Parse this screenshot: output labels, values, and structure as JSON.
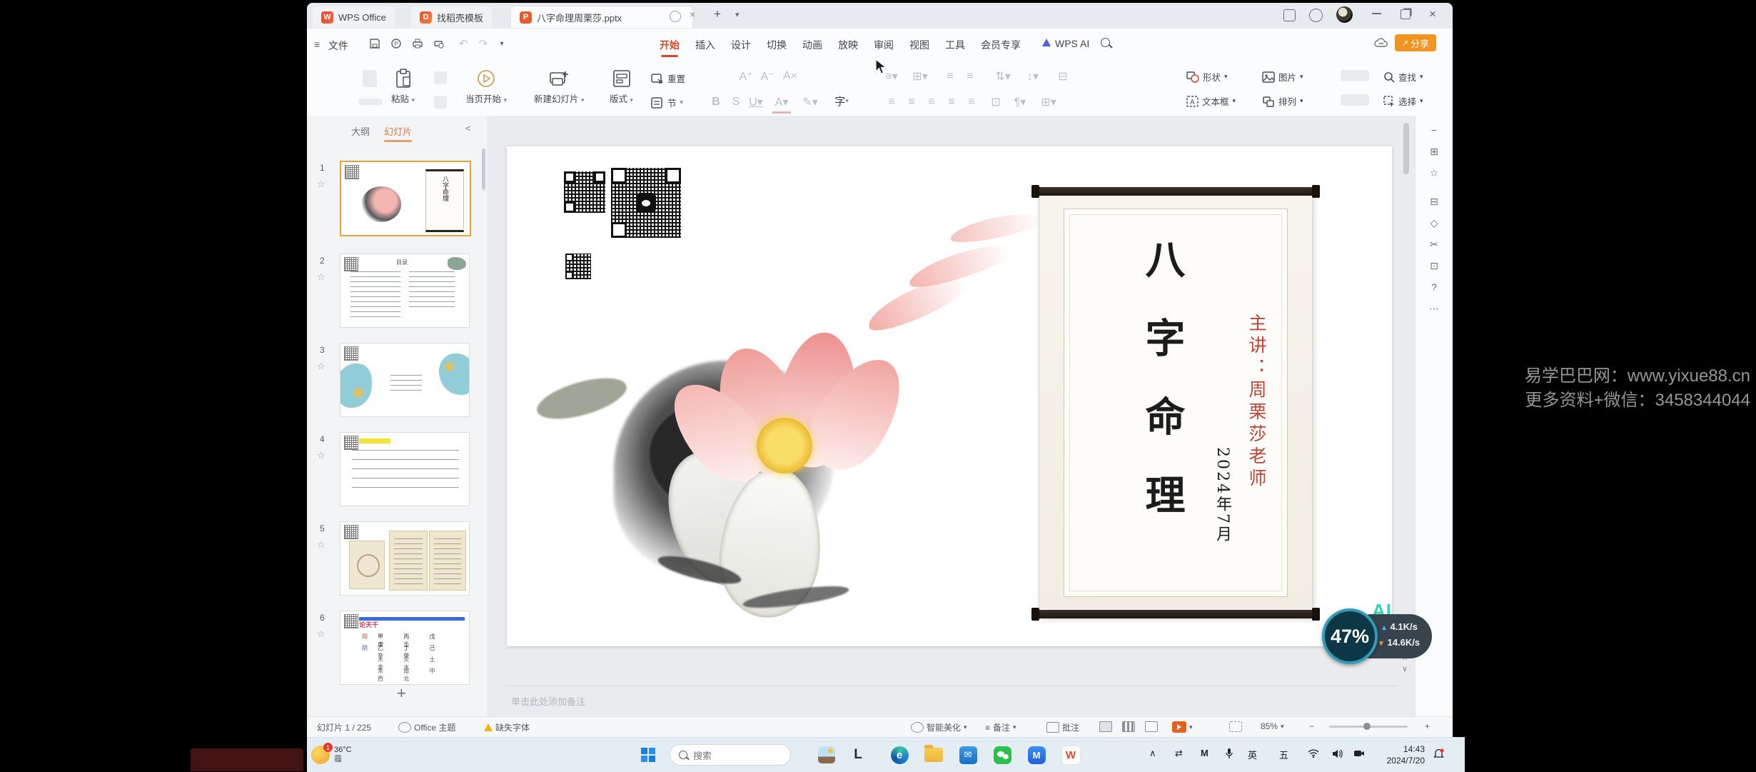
{
  "watermark": {
    "line1": "易学巴巴网：www.yixue88.cn",
    "line2": "更多资料+微信：3458344044"
  },
  "tabbar": {
    "tabs": [
      {
        "label": "WPS Office"
      },
      {
        "label": "找稻壳模板"
      },
      {
        "label": "八字命理周栗莎.pptx"
      }
    ]
  },
  "menubar": {
    "file": "文件",
    "items": [
      "开始",
      "插入",
      "设计",
      "切换",
      "动画",
      "放映",
      "审阅",
      "视图",
      "工具",
      "会员专享",
      "WPS AI"
    ],
    "share": "分享"
  },
  "ribbon": {
    "paste": "粘贴",
    "from_current": "当页开始",
    "new_slide": "新建幻灯片",
    "layout": "版式",
    "reset": "重置",
    "section": "节",
    "shapes": "形状",
    "picture": "图片",
    "find": "查找",
    "textbox": "文本框",
    "arrange": "排列",
    "select": "选择"
  },
  "sidebar": {
    "tab_outline": "大纲",
    "tab_slides": "幻灯片",
    "slide_numbers": [
      "1",
      "2",
      "3",
      "4",
      "5",
      "6"
    ],
    "slide2_title": "目录",
    "slide6_title": "论天干",
    "s6_label_yang": "阳",
    "s6_label_yin": "阴",
    "s6_yang": "甲 丙 戊 庚 壬",
    "s6_yin": "乙 丁 己 辛 癸",
    "s6_row3": "木 火 土 金 水",
    "s6_row4": "东 南 中 西 北"
  },
  "slide": {
    "scroll_title": "八字命理",
    "speaker": "主讲：周栗莎老师",
    "date": "2024年7月"
  },
  "notes": {
    "placeholder": "单击此处添加备注"
  },
  "statusbar": {
    "slide_count": "幻灯片 1 / 225",
    "theme": "Office 主题",
    "missing_font": "缺失字体",
    "beautify": "智能美化",
    "notes": "备注",
    "comments": "批注",
    "zoom": "85%"
  },
  "floating": {
    "ai": "AI",
    "percent": "47%",
    "up_speed": "4.1K/s",
    "down_speed": "14.6K/s"
  },
  "taskbar": {
    "temp": "36°C",
    "condition": "霾",
    "badge": "1",
    "search_placeholder": "搜索",
    "ime_lang": "英",
    "ime_mode": "五",
    "time": "14:43",
    "date": "2024/7/20"
  },
  "colors": {
    "accent": "#d2492a",
    "share_bg": "#f29422",
    "play_bg": "#e8611c"
  }
}
